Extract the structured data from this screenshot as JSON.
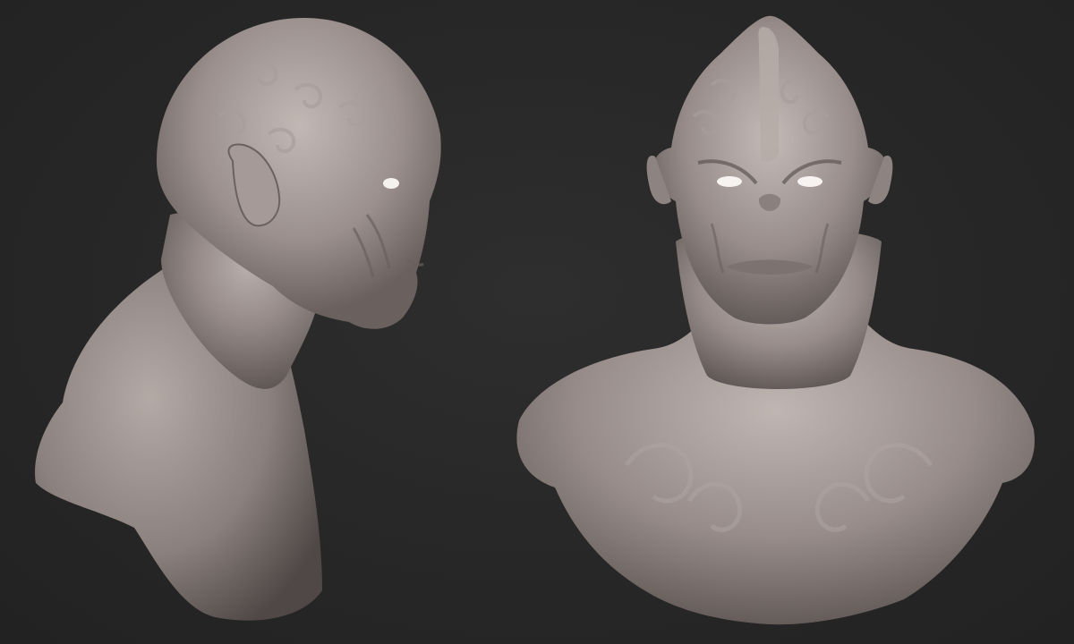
{
  "scene": {
    "background_color": "#262626",
    "material": {
      "base_color": "#8f8582",
      "highlight_color": "#cbc3c0",
      "shadow_color": "#4a4341"
    },
    "views": [
      {
        "id": "side",
        "description_icon": "bust-profile-view"
      },
      {
        "id": "front",
        "description_icon": "bust-front-view"
      }
    ]
  }
}
